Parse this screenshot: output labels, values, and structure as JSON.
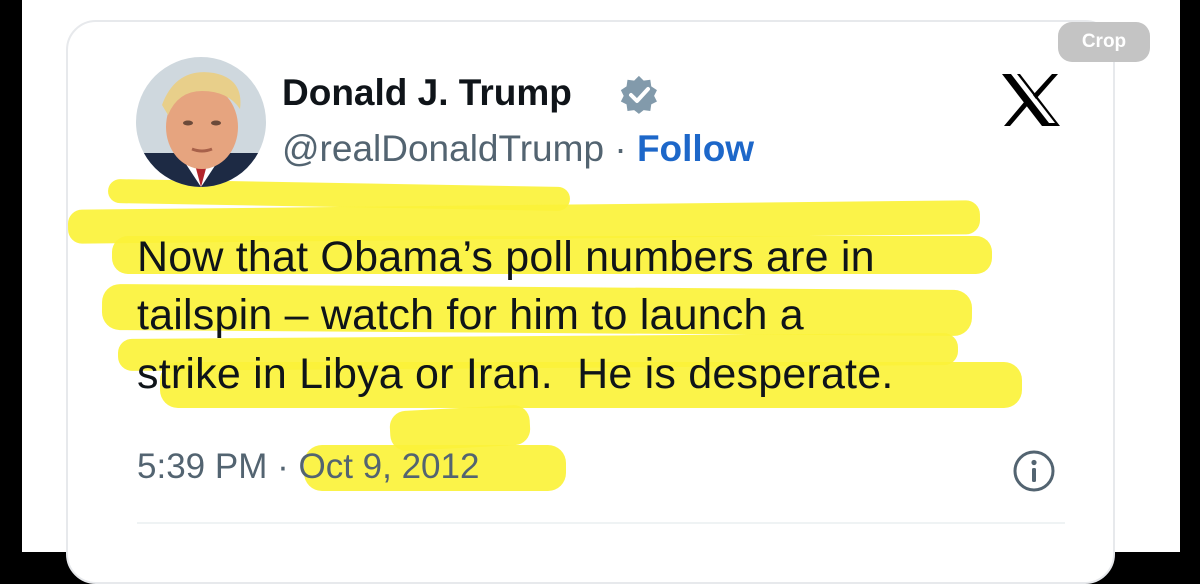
{
  "toolbar": {
    "crop_label": "Crop"
  },
  "tweet": {
    "author_name": "Donald J. Trump",
    "handle": "@realDonaldTrump",
    "separator": "·",
    "follow_label": "Follow",
    "text_lines": [
      "Now that Obama’s poll numbers are in",
      "tailspin – watch for him to launch a",
      "strike in Libya or Iran.  He is desperate."
    ],
    "time": "5:39 PM",
    "date": "Oct 9, 2012"
  },
  "icons": {
    "verified": "verified-badge-icon",
    "logo": "x-logo-icon",
    "info": "info-icon"
  },
  "colors": {
    "highlight": "#fbf23a",
    "follow": "#1d67c9",
    "verified": "#829aab",
    "text": "#0f1419",
    "muted": "#536471"
  }
}
